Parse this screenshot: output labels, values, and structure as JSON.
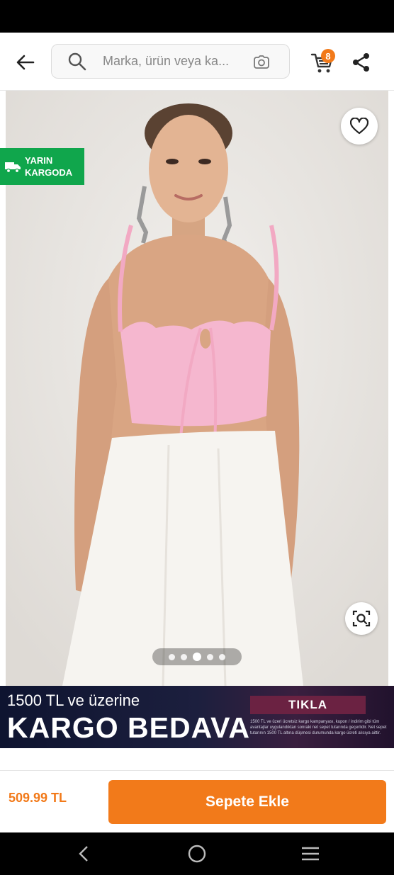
{
  "header": {
    "search_placeholder": "Marka, ürün veya ka...",
    "cart_count": "8"
  },
  "product": {
    "image_alt": "Pembe fırfırlı askılı crop bluz",
    "delivery_badge": [
      "YARIN",
      "KARGODA"
    ],
    "pager": {
      "total": 5,
      "active_index": 2
    }
  },
  "promo": {
    "line1": "1500 TL ve üzerine",
    "line2": "KARGO BEDAVA",
    "cta": "TIKLA",
    "fine_print": "1500 TL ve üzeri ücretsiz kargo kampanyası, kupon / indirim gibi tüm avantajlar uygulandıktan sonraki net sepet tutarında geçerlidir. Net sepet tutarının 1500 TL altına düşmesi durumunda kargo ücreti alıcıya aittir."
  },
  "bottom_bar": {
    "price": "509.99 TL",
    "add_to_cart": "Sepete Ekle"
  },
  "colors": {
    "brand_orange": "#f27a1a",
    "delivery_green": "#10a64c",
    "promo_cta": "#6b2242"
  },
  "icons": [
    "back-arrow-icon",
    "search-icon",
    "camera-icon",
    "cart-icon",
    "share-icon",
    "heart-icon",
    "truck-icon",
    "zoom-scan-icon",
    "nav-back-icon",
    "nav-home-icon",
    "nav-menu-icon"
  ]
}
